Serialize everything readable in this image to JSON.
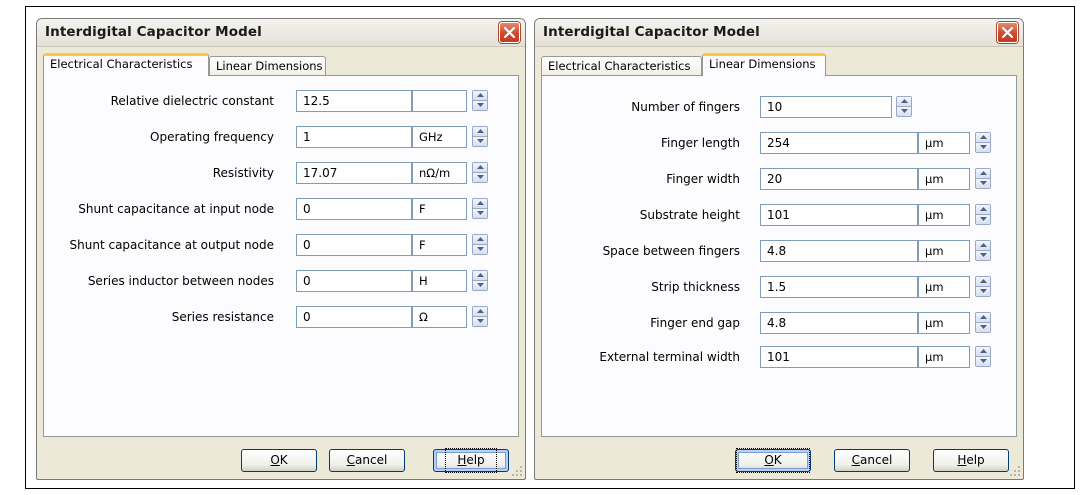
{
  "dialogs": [
    {
      "title": "Interdigital Capacitor Model",
      "tabs": [
        "Electrical Characteristics",
        "Linear Dimensions"
      ],
      "active_tab": 0,
      "rows": [
        {
          "label": "Relative dielectric constant",
          "value": "12.5",
          "unit": ""
        },
        {
          "label": "Operating frequency",
          "value": "1",
          "unit": "GHz"
        },
        {
          "label": "Resistivity",
          "value": "17.07",
          "unit": "nΩ/m"
        },
        {
          "label": "Shunt capacitance at input node",
          "value": "0",
          "unit": "F"
        },
        {
          "label": "Shunt capacitance at output node",
          "value": "0",
          "unit": "F"
        },
        {
          "label": "Series inductor between nodes",
          "value": "0",
          "unit": "H"
        },
        {
          "label": "Series resistance",
          "value": "0",
          "unit": "Ω"
        }
      ],
      "buttons": {
        "ok_pre": "",
        "ok_ul": "O",
        "ok_post": "K",
        "cancel_ul": "C",
        "cancel_post": "ancel",
        "help_ul": "H",
        "help_post": "elp"
      },
      "focused_button": "help"
    },
    {
      "title": "Interdigital Capacitor Model",
      "tabs": [
        "Electrical Characteristics",
        "Linear Dimensions"
      ],
      "active_tab": 1,
      "first_row": {
        "label": "Number of fingers",
        "value": "10"
      },
      "rows": [
        {
          "label": "Finger length",
          "value": "254",
          "unit": "µm"
        },
        {
          "label": "Finger width",
          "value": "20",
          "unit": "µm"
        },
        {
          "label": "Substrate height",
          "value": "101",
          "unit": "µm"
        },
        {
          "label": "Space between fingers",
          "value": "4.8",
          "unit": "µm"
        },
        {
          "label": "Strip thickness",
          "value": "1.5",
          "unit": "µm"
        },
        {
          "label": "Finger end gap",
          "value": "4.8",
          "unit": "µm"
        },
        {
          "label": "External terminal width",
          "value": "101",
          "unit": "µm"
        }
      ],
      "buttons": {
        "ok_ul": "O",
        "ok_post": "K",
        "cancel_ul": "C",
        "cancel_post": "ancel",
        "help_ul": "H",
        "help_post": "elp"
      },
      "focused_button": "ok"
    }
  ],
  "colors": {
    "tab_highlight": "#ffc83c",
    "close_red": "#d2482b",
    "dialog_bg": "#ece9d8"
  },
  "icons": {
    "close": "close-x-icon",
    "spin_up": "spin-up-arrow-icon",
    "spin_down": "spin-down-arrow-icon",
    "grip": "resize-grip-icon"
  }
}
